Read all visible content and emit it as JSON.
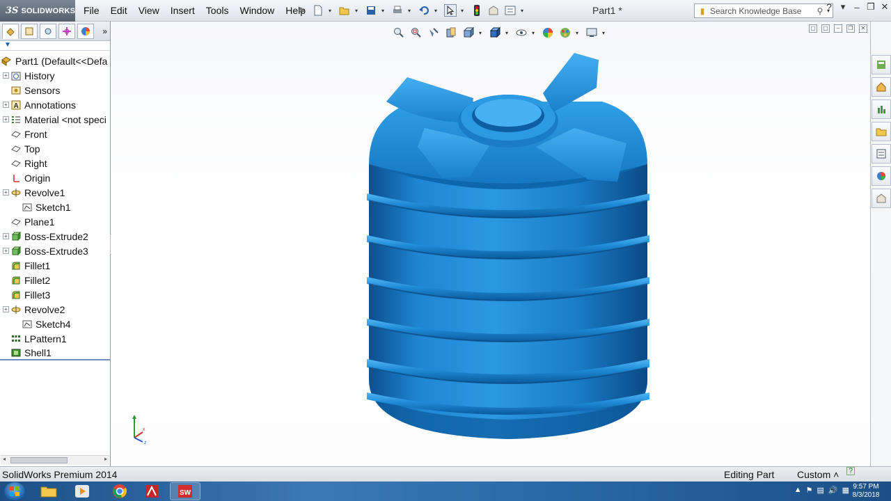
{
  "app": {
    "brand_prefix": "3S",
    "brand_name": "SOLIDWORKS",
    "document_title": "Part1 *"
  },
  "menu": [
    "File",
    "Edit",
    "View",
    "Insert",
    "Tools",
    "Window",
    "Help"
  ],
  "search": {
    "placeholder": "Search Knowledge Base"
  },
  "feature_tree": {
    "root": "Part1  (Default<<Defa",
    "items": [
      {
        "label": "History",
        "icon": "history-icon"
      },
      {
        "label": "Sensors",
        "icon": "sensors-icon"
      },
      {
        "label": "Annotations",
        "icon": "annotations-icon"
      },
      {
        "label": "Material <not speci",
        "icon": "material-icon"
      },
      {
        "label": "Front",
        "icon": "plane-icon"
      },
      {
        "label": "Top",
        "icon": "plane-icon"
      },
      {
        "label": "Right",
        "icon": "plane-icon"
      },
      {
        "label": "Origin",
        "icon": "origin-icon"
      },
      {
        "label": "Revolve1",
        "icon": "revolve-icon"
      },
      {
        "label": "Sketch1",
        "icon": "sketch-icon"
      },
      {
        "label": "Plane1",
        "icon": "plane-icon"
      },
      {
        "label": "Boss-Extrude2",
        "icon": "extrude-icon"
      },
      {
        "label": "Boss-Extrude3",
        "icon": "extrude-icon"
      },
      {
        "label": "Fillet1",
        "icon": "fillet-icon"
      },
      {
        "label": "Fillet2",
        "icon": "fillet-icon"
      },
      {
        "label": "Fillet3",
        "icon": "fillet-icon"
      },
      {
        "label": "Revolve2",
        "icon": "revolve-icon"
      },
      {
        "label": "Sketch4",
        "icon": "sketch-icon"
      },
      {
        "label": "LPattern1",
        "icon": "linear-pattern-icon"
      },
      {
        "label": "Shell1",
        "icon": "shell-icon"
      }
    ]
  },
  "model": {
    "color": "#1e88d4"
  },
  "statusbar": {
    "app_name": "SolidWorks Premium 2014",
    "mode": "Editing Part",
    "units": "Custom",
    "units_arrow": "˄"
  },
  "taskbar": {
    "time": "9:57 PM",
    "date": "8/3/2018"
  }
}
